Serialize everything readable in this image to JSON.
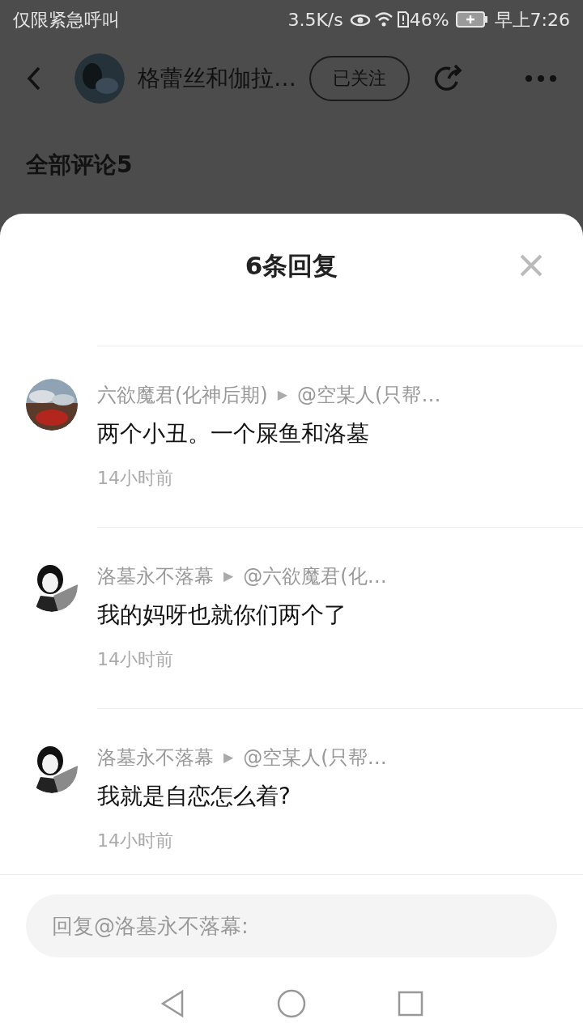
{
  "status_bar": {
    "carrier": "仅限紧急呼叫",
    "speed": "3.5K/s",
    "battery": "46%",
    "time": "早上7:26"
  },
  "header": {
    "title": "格蕾丝和伽拉…",
    "follow": "已关注"
  },
  "section_title": "全部评论5",
  "sheet": {
    "title": "6条回复",
    "replies": [
      {
        "name": "六欲魔君(化神后期)",
        "arrow": "▶",
        "target": "@空某人(只帮…",
        "text": "两个小丑。一个屎鱼和洛墓",
        "time": "14小时前"
      },
      {
        "name": "洛墓永不落幕",
        "arrow": "▶",
        "target": "@六欲魔君(化…",
        "text": "我的妈呀也就你们两个了",
        "time": "14小时前"
      },
      {
        "name": "洛墓永不落幕",
        "arrow": "▶",
        "target": "@空某人(只帮…",
        "text": "我就是自恋怎么着?",
        "time": "14小时前"
      }
    ],
    "input": {
      "placeholder": "回复@洛墓永不落幕:"
    }
  }
}
